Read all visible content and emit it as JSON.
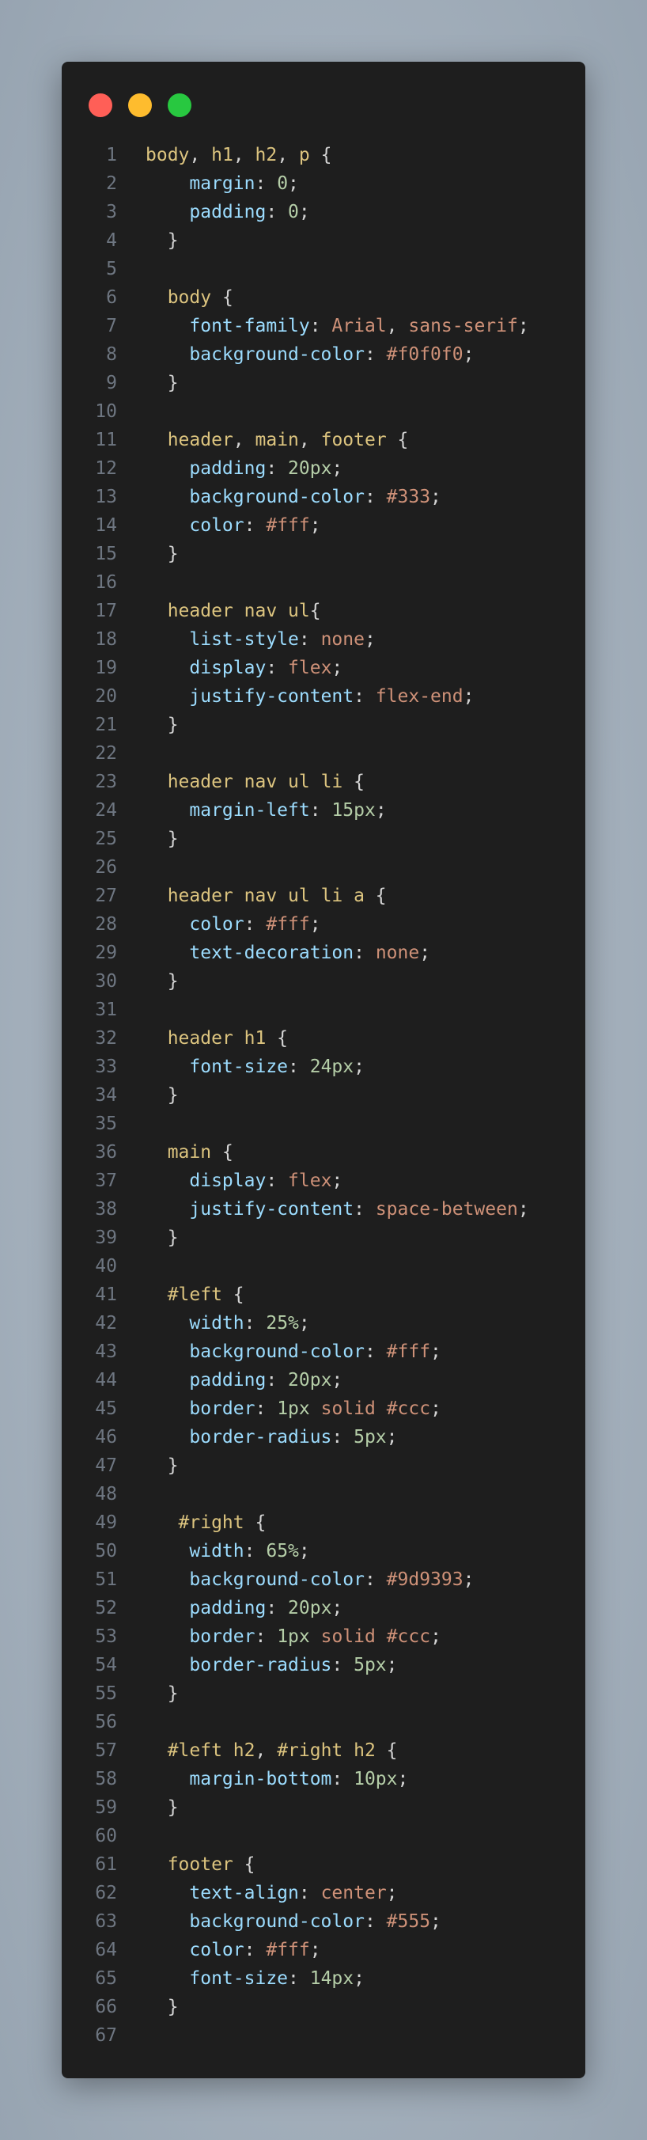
{
  "window": {
    "buttons": [
      "close",
      "minimize",
      "maximize"
    ]
  },
  "colors": {
    "background": "#1e1e1e",
    "selector": "#dcc47f",
    "property": "#9cdcfe",
    "number": "#b5cea8",
    "string": "#ce9178",
    "punctuation": "#d4d4d4",
    "line_number": "#6e7681"
  },
  "code": {
    "lines": [
      {
        "n": "1",
        "tokens": [
          [
            "sel",
            "body"
          ],
          [
            "punc",
            ", "
          ],
          [
            "sel",
            "h1"
          ],
          [
            "punc",
            ", "
          ],
          [
            "sel",
            "h2"
          ],
          [
            "punc",
            ", "
          ],
          [
            "sel",
            "p"
          ],
          [
            "punc",
            " {"
          ]
        ]
      },
      {
        "n": "2",
        "tokens": [
          [
            "punc",
            "    "
          ],
          [
            "prop",
            "margin"
          ],
          [
            "punc",
            ": "
          ],
          [
            "num",
            "0"
          ],
          [
            "punc",
            ";"
          ]
        ]
      },
      {
        "n": "3",
        "tokens": [
          [
            "punc",
            "    "
          ],
          [
            "prop",
            "padding"
          ],
          [
            "punc",
            ": "
          ],
          [
            "num",
            "0"
          ],
          [
            "punc",
            ";"
          ]
        ]
      },
      {
        "n": "4",
        "tokens": [
          [
            "punc",
            "  }"
          ]
        ]
      },
      {
        "n": "5",
        "tokens": []
      },
      {
        "n": "6",
        "tokens": [
          [
            "punc",
            "  "
          ],
          [
            "sel",
            "body"
          ],
          [
            "punc",
            " {"
          ]
        ]
      },
      {
        "n": "7",
        "tokens": [
          [
            "punc",
            "    "
          ],
          [
            "prop",
            "font-family"
          ],
          [
            "punc",
            ": "
          ],
          [
            "str",
            "Arial"
          ],
          [
            "punc",
            ", "
          ],
          [
            "str",
            "sans-serif"
          ],
          [
            "punc",
            ";"
          ]
        ]
      },
      {
        "n": "8",
        "tokens": [
          [
            "punc",
            "    "
          ],
          [
            "prop",
            "background-color"
          ],
          [
            "punc",
            ": "
          ],
          [
            "str",
            "#f0f0f0"
          ],
          [
            "punc",
            ";"
          ]
        ]
      },
      {
        "n": "9",
        "tokens": [
          [
            "punc",
            "  }"
          ]
        ]
      },
      {
        "n": "10",
        "tokens": []
      },
      {
        "n": "11",
        "tokens": [
          [
            "punc",
            "  "
          ],
          [
            "sel",
            "header"
          ],
          [
            "punc",
            ", "
          ],
          [
            "sel",
            "main"
          ],
          [
            "punc",
            ", "
          ],
          [
            "sel",
            "footer"
          ],
          [
            "punc",
            " {"
          ]
        ]
      },
      {
        "n": "12",
        "tokens": [
          [
            "punc",
            "    "
          ],
          [
            "prop",
            "padding"
          ],
          [
            "punc",
            ": "
          ],
          [
            "num",
            "20px"
          ],
          [
            "punc",
            ";"
          ]
        ]
      },
      {
        "n": "13",
        "tokens": [
          [
            "punc",
            "    "
          ],
          [
            "prop",
            "background-color"
          ],
          [
            "punc",
            ": "
          ],
          [
            "str",
            "#333"
          ],
          [
            "punc",
            ";"
          ]
        ]
      },
      {
        "n": "14",
        "tokens": [
          [
            "punc",
            "    "
          ],
          [
            "prop",
            "color"
          ],
          [
            "punc",
            ": "
          ],
          [
            "str",
            "#fff"
          ],
          [
            "punc",
            ";"
          ]
        ]
      },
      {
        "n": "15",
        "tokens": [
          [
            "punc",
            "  }"
          ]
        ]
      },
      {
        "n": "16",
        "tokens": []
      },
      {
        "n": "17",
        "tokens": [
          [
            "punc",
            "  "
          ],
          [
            "sel",
            "header nav ul"
          ],
          [
            "punc",
            "{"
          ]
        ]
      },
      {
        "n": "18",
        "tokens": [
          [
            "punc",
            "    "
          ],
          [
            "prop",
            "list-style"
          ],
          [
            "punc",
            ": "
          ],
          [
            "str",
            "none"
          ],
          [
            "punc",
            ";"
          ]
        ]
      },
      {
        "n": "19",
        "tokens": [
          [
            "punc",
            "    "
          ],
          [
            "prop",
            "display"
          ],
          [
            "punc",
            ": "
          ],
          [
            "str",
            "flex"
          ],
          [
            "punc",
            ";"
          ]
        ]
      },
      {
        "n": "20",
        "tokens": [
          [
            "punc",
            "    "
          ],
          [
            "prop",
            "justify-content"
          ],
          [
            "punc",
            ": "
          ],
          [
            "str",
            "flex-end"
          ],
          [
            "punc",
            ";"
          ]
        ]
      },
      {
        "n": "21",
        "tokens": [
          [
            "punc",
            "  }"
          ]
        ]
      },
      {
        "n": "22",
        "tokens": []
      },
      {
        "n": "23",
        "tokens": [
          [
            "punc",
            "  "
          ],
          [
            "sel",
            "header nav ul li"
          ],
          [
            "punc",
            " {"
          ]
        ]
      },
      {
        "n": "24",
        "tokens": [
          [
            "punc",
            "    "
          ],
          [
            "prop",
            "margin-left"
          ],
          [
            "punc",
            ": "
          ],
          [
            "num",
            "15px"
          ],
          [
            "punc",
            ";"
          ]
        ]
      },
      {
        "n": "25",
        "tokens": [
          [
            "punc",
            "  }"
          ]
        ]
      },
      {
        "n": "26",
        "tokens": []
      },
      {
        "n": "27",
        "tokens": [
          [
            "punc",
            "  "
          ],
          [
            "sel",
            "header nav ul li a"
          ],
          [
            "punc",
            " {"
          ]
        ]
      },
      {
        "n": "28",
        "tokens": [
          [
            "punc",
            "    "
          ],
          [
            "prop",
            "color"
          ],
          [
            "punc",
            ": "
          ],
          [
            "str",
            "#fff"
          ],
          [
            "punc",
            ";"
          ]
        ]
      },
      {
        "n": "29",
        "tokens": [
          [
            "punc",
            "    "
          ],
          [
            "prop",
            "text-decoration"
          ],
          [
            "punc",
            ": "
          ],
          [
            "str",
            "none"
          ],
          [
            "punc",
            ";"
          ]
        ]
      },
      {
        "n": "30",
        "tokens": [
          [
            "punc",
            "  }"
          ]
        ]
      },
      {
        "n": "31",
        "tokens": []
      },
      {
        "n": "32",
        "tokens": [
          [
            "punc",
            "  "
          ],
          [
            "sel",
            "header h1"
          ],
          [
            "punc",
            " {"
          ]
        ]
      },
      {
        "n": "33",
        "tokens": [
          [
            "punc",
            "    "
          ],
          [
            "prop",
            "font-size"
          ],
          [
            "punc",
            ": "
          ],
          [
            "num",
            "24px"
          ],
          [
            "punc",
            ";"
          ]
        ]
      },
      {
        "n": "34",
        "tokens": [
          [
            "punc",
            "  }"
          ]
        ]
      },
      {
        "n": "35",
        "tokens": []
      },
      {
        "n": "36",
        "tokens": [
          [
            "punc",
            "  "
          ],
          [
            "sel",
            "main"
          ],
          [
            "punc",
            " {"
          ]
        ]
      },
      {
        "n": "37",
        "tokens": [
          [
            "punc",
            "    "
          ],
          [
            "prop",
            "display"
          ],
          [
            "punc",
            ": "
          ],
          [
            "str",
            "flex"
          ],
          [
            "punc",
            ";"
          ]
        ]
      },
      {
        "n": "38",
        "tokens": [
          [
            "punc",
            "    "
          ],
          [
            "prop",
            "justify-content"
          ],
          [
            "punc",
            ": "
          ],
          [
            "str",
            "space-between"
          ],
          [
            "punc",
            ";"
          ]
        ]
      },
      {
        "n": "39",
        "tokens": [
          [
            "punc",
            "  }"
          ]
        ]
      },
      {
        "n": "40",
        "tokens": []
      },
      {
        "n": "41",
        "tokens": [
          [
            "punc",
            "  "
          ],
          [
            "sel",
            "#left"
          ],
          [
            "punc",
            " {"
          ]
        ]
      },
      {
        "n": "42",
        "tokens": [
          [
            "punc",
            "    "
          ],
          [
            "prop",
            "width"
          ],
          [
            "punc",
            ": "
          ],
          [
            "num",
            "25%"
          ],
          [
            "punc",
            ";"
          ]
        ]
      },
      {
        "n": "43",
        "tokens": [
          [
            "punc",
            "    "
          ],
          [
            "prop",
            "background-color"
          ],
          [
            "punc",
            ": "
          ],
          [
            "str",
            "#fff"
          ],
          [
            "punc",
            ";"
          ]
        ]
      },
      {
        "n": "44",
        "tokens": [
          [
            "punc",
            "    "
          ],
          [
            "prop",
            "padding"
          ],
          [
            "punc",
            ": "
          ],
          [
            "num",
            "20px"
          ],
          [
            "punc",
            ";"
          ]
        ]
      },
      {
        "n": "45",
        "tokens": [
          [
            "punc",
            "    "
          ],
          [
            "prop",
            "border"
          ],
          [
            "punc",
            ": "
          ],
          [
            "num",
            "1px"
          ],
          [
            "punc",
            " "
          ],
          [
            "str",
            "solid"
          ],
          [
            "punc",
            " "
          ],
          [
            "str",
            "#ccc"
          ],
          [
            "punc",
            ";"
          ]
        ]
      },
      {
        "n": "46",
        "tokens": [
          [
            "punc",
            "    "
          ],
          [
            "prop",
            "border-radius"
          ],
          [
            "punc",
            ": "
          ],
          [
            "num",
            "5px"
          ],
          [
            "punc",
            ";"
          ]
        ]
      },
      {
        "n": "47",
        "tokens": [
          [
            "punc",
            "  }"
          ]
        ]
      },
      {
        "n": "48",
        "tokens": []
      },
      {
        "n": "49",
        "tokens": [
          [
            "punc",
            "   "
          ],
          [
            "sel",
            "#right"
          ],
          [
            "punc",
            " {"
          ]
        ]
      },
      {
        "n": "50",
        "tokens": [
          [
            "punc",
            "    "
          ],
          [
            "prop",
            "width"
          ],
          [
            "punc",
            ": "
          ],
          [
            "num",
            "65%"
          ],
          [
            "punc",
            ";"
          ]
        ]
      },
      {
        "n": "51",
        "tokens": [
          [
            "punc",
            "    "
          ],
          [
            "prop",
            "background-color"
          ],
          [
            "punc",
            ": "
          ],
          [
            "str",
            "#9d9393"
          ],
          [
            "punc",
            ";"
          ]
        ]
      },
      {
        "n": "52",
        "tokens": [
          [
            "punc",
            "    "
          ],
          [
            "prop",
            "padding"
          ],
          [
            "punc",
            ": "
          ],
          [
            "num",
            "20px"
          ],
          [
            "punc",
            ";"
          ]
        ]
      },
      {
        "n": "53",
        "tokens": [
          [
            "punc",
            "    "
          ],
          [
            "prop",
            "border"
          ],
          [
            "punc",
            ": "
          ],
          [
            "num",
            "1px"
          ],
          [
            "punc",
            " "
          ],
          [
            "str",
            "solid"
          ],
          [
            "punc",
            " "
          ],
          [
            "str",
            "#ccc"
          ],
          [
            "punc",
            ";"
          ]
        ]
      },
      {
        "n": "54",
        "tokens": [
          [
            "punc",
            "    "
          ],
          [
            "prop",
            "border-radius"
          ],
          [
            "punc",
            ": "
          ],
          [
            "num",
            "5px"
          ],
          [
            "punc",
            ";"
          ]
        ]
      },
      {
        "n": "55",
        "tokens": [
          [
            "punc",
            "  }"
          ]
        ]
      },
      {
        "n": "56",
        "tokens": []
      },
      {
        "n": "57",
        "tokens": [
          [
            "punc",
            "  "
          ],
          [
            "sel",
            "#left h2"
          ],
          [
            "punc",
            ", "
          ],
          [
            "sel",
            "#right h2"
          ],
          [
            "punc",
            " {"
          ]
        ]
      },
      {
        "n": "58",
        "tokens": [
          [
            "punc",
            "    "
          ],
          [
            "prop",
            "margin-bottom"
          ],
          [
            "punc",
            ": "
          ],
          [
            "num",
            "10px"
          ],
          [
            "punc",
            ";"
          ]
        ]
      },
      {
        "n": "59",
        "tokens": [
          [
            "punc",
            "  }"
          ]
        ]
      },
      {
        "n": "60",
        "tokens": []
      },
      {
        "n": "61",
        "tokens": [
          [
            "punc",
            "  "
          ],
          [
            "sel",
            "footer"
          ],
          [
            "punc",
            " {"
          ]
        ]
      },
      {
        "n": "62",
        "tokens": [
          [
            "punc",
            "    "
          ],
          [
            "prop",
            "text-align"
          ],
          [
            "punc",
            ": "
          ],
          [
            "str",
            "center"
          ],
          [
            "punc",
            ";"
          ]
        ]
      },
      {
        "n": "63",
        "tokens": [
          [
            "punc",
            "    "
          ],
          [
            "prop",
            "background-color"
          ],
          [
            "punc",
            ": "
          ],
          [
            "str",
            "#555"
          ],
          [
            "punc",
            ";"
          ]
        ]
      },
      {
        "n": "64",
        "tokens": [
          [
            "punc",
            "    "
          ],
          [
            "prop",
            "color"
          ],
          [
            "punc",
            ": "
          ],
          [
            "str",
            "#fff"
          ],
          [
            "punc",
            ";"
          ]
        ]
      },
      {
        "n": "65",
        "tokens": [
          [
            "punc",
            "    "
          ],
          [
            "prop",
            "font-size"
          ],
          [
            "punc",
            ": "
          ],
          [
            "num",
            "14px"
          ],
          [
            "punc",
            ";"
          ]
        ]
      },
      {
        "n": "66",
        "tokens": [
          [
            "punc",
            "  }"
          ]
        ]
      },
      {
        "n": "67",
        "tokens": []
      }
    ]
  }
}
